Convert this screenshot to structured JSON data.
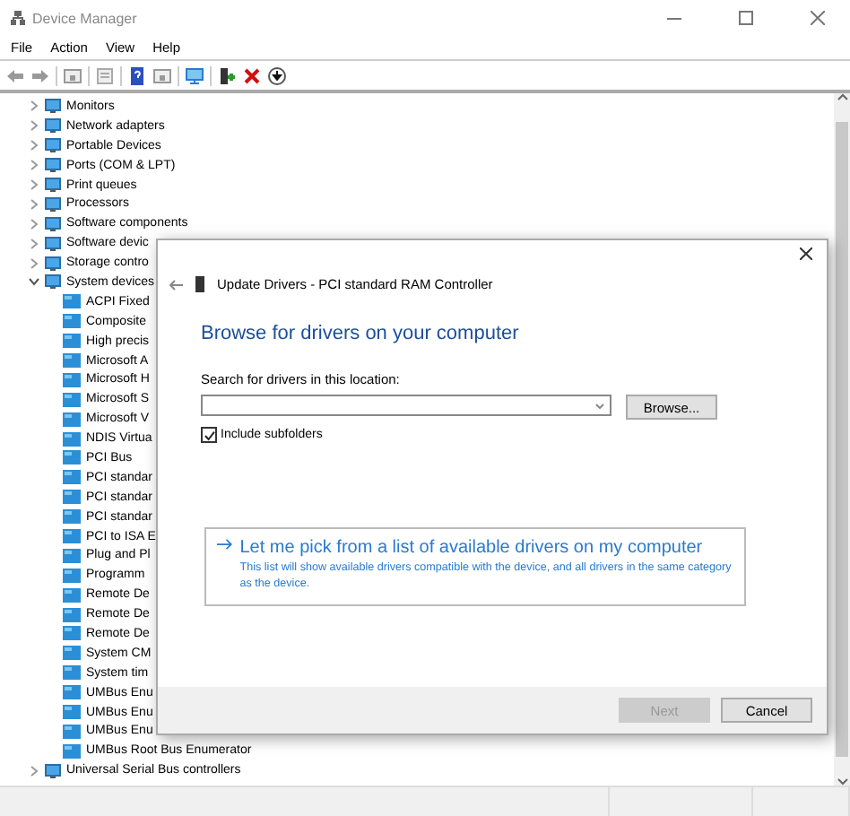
{
  "window": {
    "title": "Device Manager"
  },
  "menu": [
    "File",
    "Action",
    "View",
    "Help"
  ],
  "tree": [
    {
      "label": "Monitors",
      "expanded": false
    },
    {
      "label": "Network adapters",
      "expanded": false
    },
    {
      "label": "Portable Devices",
      "expanded": false
    },
    {
      "label": "Ports (COM & LPT)",
      "expanded": false
    },
    {
      "label": "Print queues",
      "expanded": false
    },
    {
      "label": "Processors",
      "expanded": false
    },
    {
      "label": "Software components",
      "expanded": false
    },
    {
      "label": "Software devic",
      "expanded": false
    },
    {
      "label": "Storage contro",
      "expanded": false
    },
    {
      "label": "System devices",
      "expanded": true,
      "children": [
        {
          "label": "ACPI Fixed"
        },
        {
          "label": "Composite"
        },
        {
          "label": "High precis"
        },
        {
          "label": "Microsoft A"
        },
        {
          "label": "Microsoft H"
        },
        {
          "label": "Microsoft S"
        },
        {
          "label": "Microsoft V"
        },
        {
          "label": "NDIS Virtua"
        },
        {
          "label": "PCI Bus"
        },
        {
          "label": "PCI standar"
        },
        {
          "label": "PCI standar"
        },
        {
          "label": "PCI standar"
        },
        {
          "label": "PCI to ISA E"
        },
        {
          "label": "Plug and Pl"
        },
        {
          "label": "Programm"
        },
        {
          "label": "Remote De"
        },
        {
          "label": "Remote De"
        },
        {
          "label": "Remote De"
        },
        {
          "label": "System CM"
        },
        {
          "label": "System tim"
        },
        {
          "label": "UMBus Enu"
        },
        {
          "label": "UMBus Enu"
        },
        {
          "label": "UMBus Enu"
        },
        {
          "label": "UMBus Root Bus Enumerator"
        }
      ]
    },
    {
      "label": "Universal Serial Bus controllers",
      "expanded": false
    }
  ],
  "dialog": {
    "title": "Update Drivers - PCI standard RAM Controller",
    "heading": "Browse for drivers on your computer",
    "search_label": "Search for drivers in this location:",
    "browse_button": "Browse...",
    "include_subfolders": {
      "label": "Include subfolders",
      "checked": true
    },
    "option": {
      "title": "Let me pick from a list of available drivers on my computer",
      "description": "This list will show available drivers compatible with the device, and all drivers in the same category as the device."
    },
    "buttons": [
      {
        "label": "Next",
        "disabled": true
      },
      {
        "label": "Cancel",
        "disabled": false
      }
    ]
  }
}
